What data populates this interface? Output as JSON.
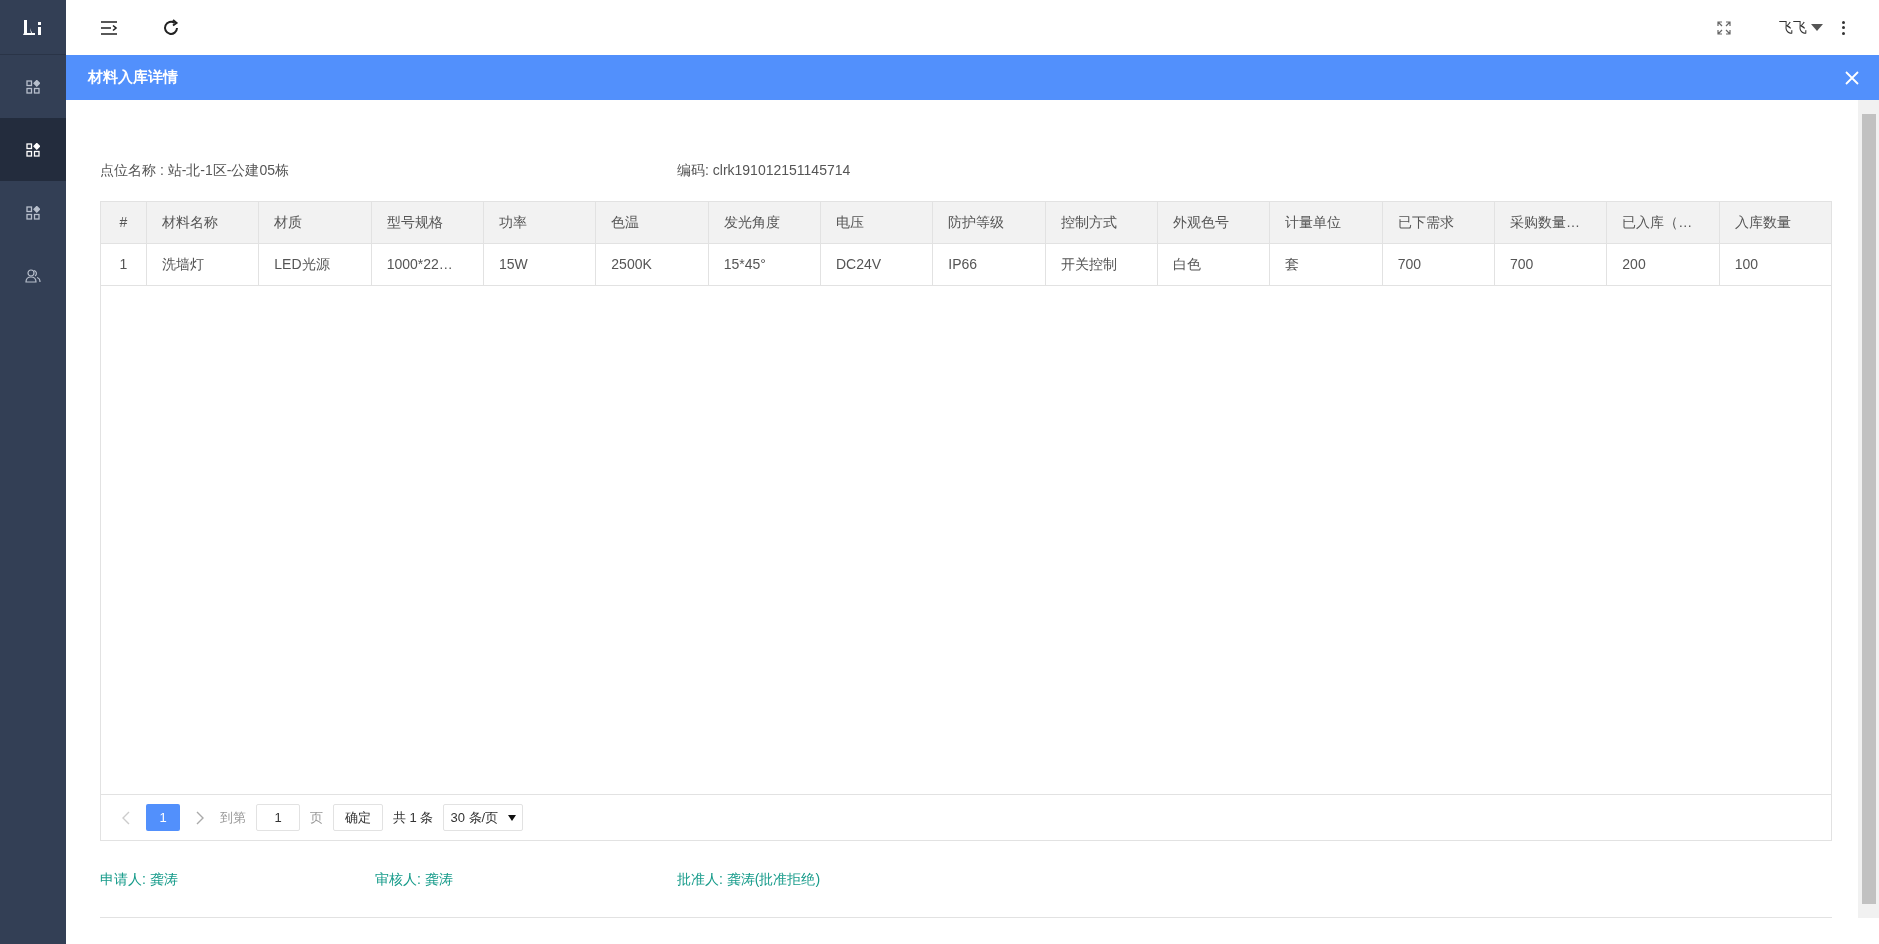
{
  "sidebar": {
    "items": [
      {
        "kind": "module",
        "selected": false
      },
      {
        "kind": "module",
        "selected": true
      },
      {
        "kind": "module",
        "selected": false
      },
      {
        "kind": "user",
        "selected": false
      }
    ]
  },
  "header": {
    "user_name": "飞飞"
  },
  "dialog": {
    "title": "材料入库详情",
    "info": [
      {
        "label": "点位名称 : 站-北-1区-公建05栋"
      },
      {
        "label": "编码: clrk191012151145714"
      }
    ],
    "table": {
      "columns": [
        "#",
        "材料名称",
        "材质",
        "型号规格",
        "功率",
        "色温",
        "发光角度",
        "电压",
        "防护等级",
        "控制方式",
        "外观色号",
        "计量单位",
        "已下需求",
        "采购数量…",
        "已入库（…",
        "入库数量"
      ],
      "rows": [
        [
          "1",
          "洗墙灯",
          "LED光源",
          "1000*22…",
          "15W",
          "2500K",
          "15*45°",
          "DC24V",
          "IP66",
          "开关控制",
          "白色",
          "套",
          "700",
          "700",
          "200",
          "100"
        ]
      ]
    },
    "pagination": {
      "pages": [
        {
          "label": "1",
          "selected": true
        }
      ],
      "goto_label": "到第",
      "goto_value": "1",
      "page_unit": "页",
      "confirm": "确定",
      "total": "共 1 条",
      "page_size": "30 条/页"
    },
    "signatures": [
      "申请人: 龚涛",
      "审核人: 龚涛",
      "批准人: 龚涛(批准拒绝)"
    ]
  }
}
